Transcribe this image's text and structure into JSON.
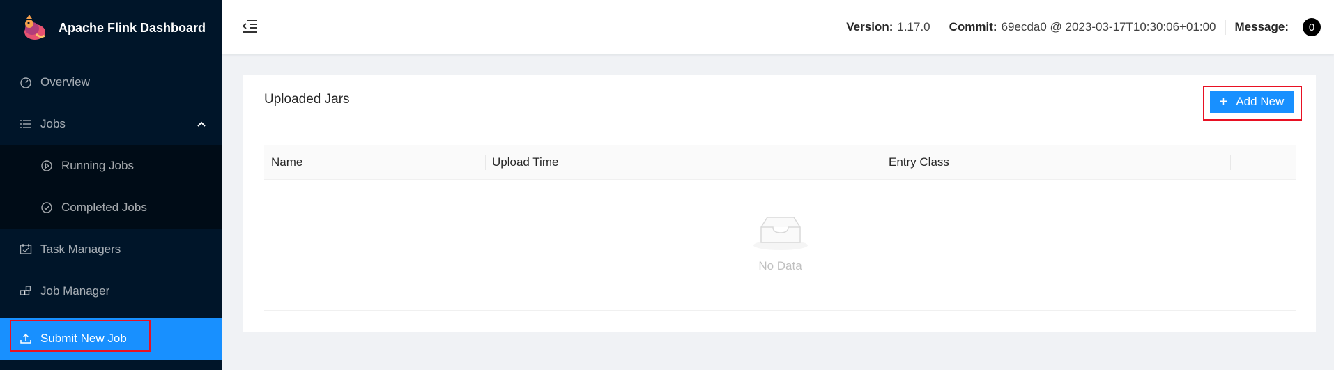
{
  "app": {
    "title": "Apache Flink Dashboard"
  },
  "sidebar": {
    "items": [
      {
        "label": "Overview",
        "icon": "dashboard-icon"
      },
      {
        "label": "Jobs",
        "icon": "list-icon",
        "expanded": true,
        "children": [
          {
            "label": "Running Jobs",
            "icon": "play-circle-icon"
          },
          {
            "label": "Completed Jobs",
            "icon": "check-circle-icon"
          }
        ]
      },
      {
        "label": "Task Managers",
        "icon": "schedule-icon"
      },
      {
        "label": "Job Manager",
        "icon": "build-icon"
      },
      {
        "label": "Submit New Job",
        "icon": "upload-icon",
        "active": true
      }
    ]
  },
  "header": {
    "version_label": "Version:",
    "version_value": "1.17.0",
    "commit_label": "Commit:",
    "commit_value": "69ecda0 @ 2023-03-17T10:30:06+01:00",
    "message_label": "Message:",
    "message_count": "0"
  },
  "main": {
    "card_title": "Uploaded Jars",
    "add_button": "Add New",
    "table": {
      "columns": [
        "Name",
        "Upload Time",
        "Entry Class",
        ""
      ],
      "rows": [],
      "empty_text": "No Data"
    }
  },
  "colors": {
    "sidebar_bg": "#001529",
    "submenu_bg": "#000c17",
    "primary": "#1890ff",
    "highlight": "#e81123"
  }
}
